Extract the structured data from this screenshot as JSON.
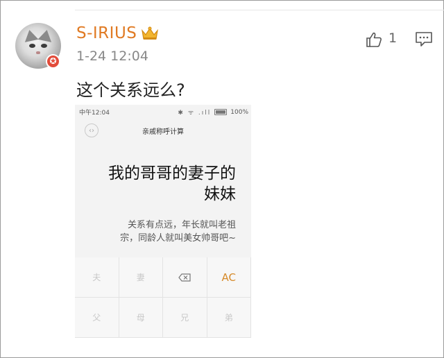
{
  "post": {
    "username": "S-IRIUS",
    "timestamp": "1-24 12:04",
    "text": "这个关系远么?",
    "like_count": "1"
  },
  "icons": {
    "badge": "crown-icon",
    "vip": "vip-badge-icon",
    "like": "thumbs-up-icon",
    "comment": "comment-icon"
  },
  "colors": {
    "username": "#e07a23",
    "accent_ac": "#d68a2a",
    "vip_badge": "#e24b3a"
  },
  "screenshot": {
    "status_time": "中午12:04",
    "status_icons": "✱ ᯤ .ıll",
    "battery": "100%",
    "app_title": "亲戚称呼计算",
    "display_line1": "我的哥哥的妻子的",
    "display_line2": "妹妹",
    "result_line1": "关系有点远，年长就叫老祖",
    "result_line2": "宗，同龄人就叫美女帅哥吧~",
    "keys_row1": [
      "夫",
      "妻",
      "",
      "AC"
    ],
    "keys_row2": [
      "父",
      "母",
      "兄",
      "弟"
    ]
  }
}
